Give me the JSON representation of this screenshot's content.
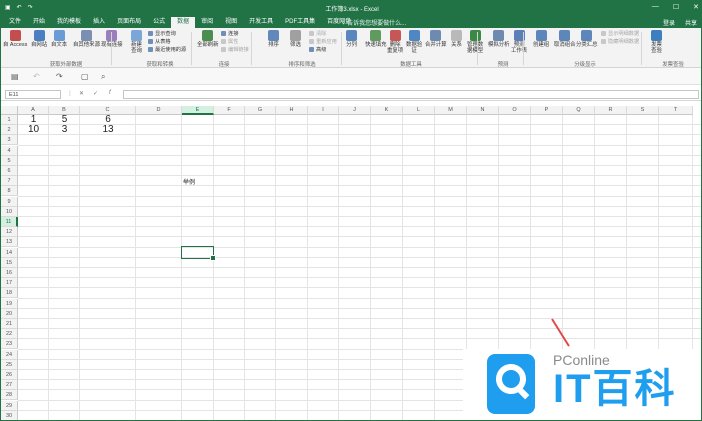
{
  "window": {
    "title": "工作簿3.xlsx - Excel",
    "controls": [
      "—",
      "☐",
      "✕"
    ]
  },
  "tabs": [
    "文件",
    "开始",
    "我的模板",
    "插入",
    "页面布局",
    "公式",
    "数据",
    "审阅",
    "视图",
    "开发工具",
    "PDF工具集",
    "百度网盘"
  ],
  "tab_active_index": 6,
  "tell_me": "♀ 告诉我您想要做什么...",
  "account": {
    "login": "登录",
    "share": "共享"
  },
  "ribbon": {
    "buttons": [
      {
        "label": "自 Access",
        "color": "#c44d4d"
      },
      {
        "label": "自网站",
        "color": "#4a7fc1"
      },
      {
        "label": "自文本",
        "color": "#6a9bd6"
      },
      {
        "label": "自其他来源",
        "color": "#7a8fb2"
      },
      {
        "label": "现有连接",
        "color": "#9a7fbd"
      },
      {
        "label": "新建\n查询",
        "color": "#7aa7d8"
      },
      {
        "label": "全部刷新",
        "color": "#4b8e4f"
      },
      {
        "label": "排序",
        "color": "#6188bb"
      },
      {
        "label": "筛选",
        "color": "#a0a0a0"
      },
      {
        "label": "分列",
        "color": "#5a86bd"
      },
      {
        "label": "快速填充",
        "color": "#5f9a5f"
      },
      {
        "label": "删除\n重复项",
        "color": "#c75757"
      },
      {
        "label": "数据验\n证",
        "color": "#4f86c4"
      },
      {
        "label": "合并计算",
        "color": "#6f8ab0"
      },
      {
        "label": "关系",
        "color": "#b9b9b9"
      },
      {
        "label": "管理数\n据模型",
        "color": "#3a8a46"
      },
      {
        "label": "模拟分析",
        "color": "#6f8ab0"
      },
      {
        "label": "预测\n工作表",
        "color": "#5b7fb7"
      },
      {
        "label": "创建组",
        "color": "#5d87bb"
      },
      {
        "label": "取消组合",
        "color": "#5d87bb"
      },
      {
        "label": "分类汇总",
        "color": "#5d87bb"
      },
      {
        "label": "发票\n查验",
        "color": "#3d7fbf"
      }
    ],
    "smalls": {
      "show_query": "显示查询",
      "from_table": "从表格",
      "recent_sources": "最近使用的源",
      "connections": "连接",
      "properties": "属性",
      "edit_links": "编辑链接",
      "clear": "清除",
      "reapply": "重新应用",
      "advanced": "高级",
      "show_detail": "显示明细数据",
      "hide_detail": "隐藏明细数据"
    },
    "groups": [
      "获取外部数据",
      "获取和转换",
      "连接",
      "排序和筛选",
      "数据工具",
      "预测",
      "分级显示",
      "发票查验"
    ]
  },
  "name_box": "E11",
  "columns": [
    "A",
    "B",
    "C",
    "D",
    "E",
    "F",
    "G",
    "H",
    "I",
    "J",
    "K",
    "L",
    "M",
    "N",
    "O",
    "P",
    "Q",
    "R",
    "S",
    "T"
  ],
  "rows": [
    "1",
    "2",
    "3",
    "4",
    "5",
    "6",
    "7",
    "8",
    "9",
    "10",
    "11",
    "12",
    "13",
    "14",
    "15",
    "16",
    "17",
    "18",
    "19",
    "20",
    "21",
    "22",
    "23",
    "24",
    "25",
    "26",
    "27",
    "28",
    "29",
    "30"
  ],
  "cells": {
    "A1": "1",
    "B1": "5",
    "C1": "6",
    "A2": "10",
    "B2": "3",
    "C2": "13",
    "E7": "举例"
  },
  "watermark": {
    "brand": "PConline",
    "big": "IT百科"
  }
}
